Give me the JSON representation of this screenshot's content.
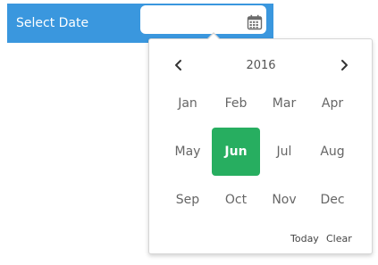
{
  "bar": {
    "label": "Select Date"
  },
  "date_input": {
    "value": "",
    "placeholder": ""
  },
  "datepicker": {
    "year": "2016",
    "months": [
      "Jan",
      "Feb",
      "Mar",
      "Apr",
      "May",
      "Jun",
      "Jul",
      "Aug",
      "Sep",
      "Oct",
      "Nov",
      "Dec"
    ],
    "selected_month": "Jun",
    "today_label": "Today",
    "clear_label": "Clear"
  },
  "icons": {
    "calendar": "calendar-icon",
    "prev": "chevron-left-icon",
    "next": "chevron-right-icon"
  },
  "colors": {
    "bar_background": "#3a97de",
    "selected_month_background": "#27ae60"
  }
}
